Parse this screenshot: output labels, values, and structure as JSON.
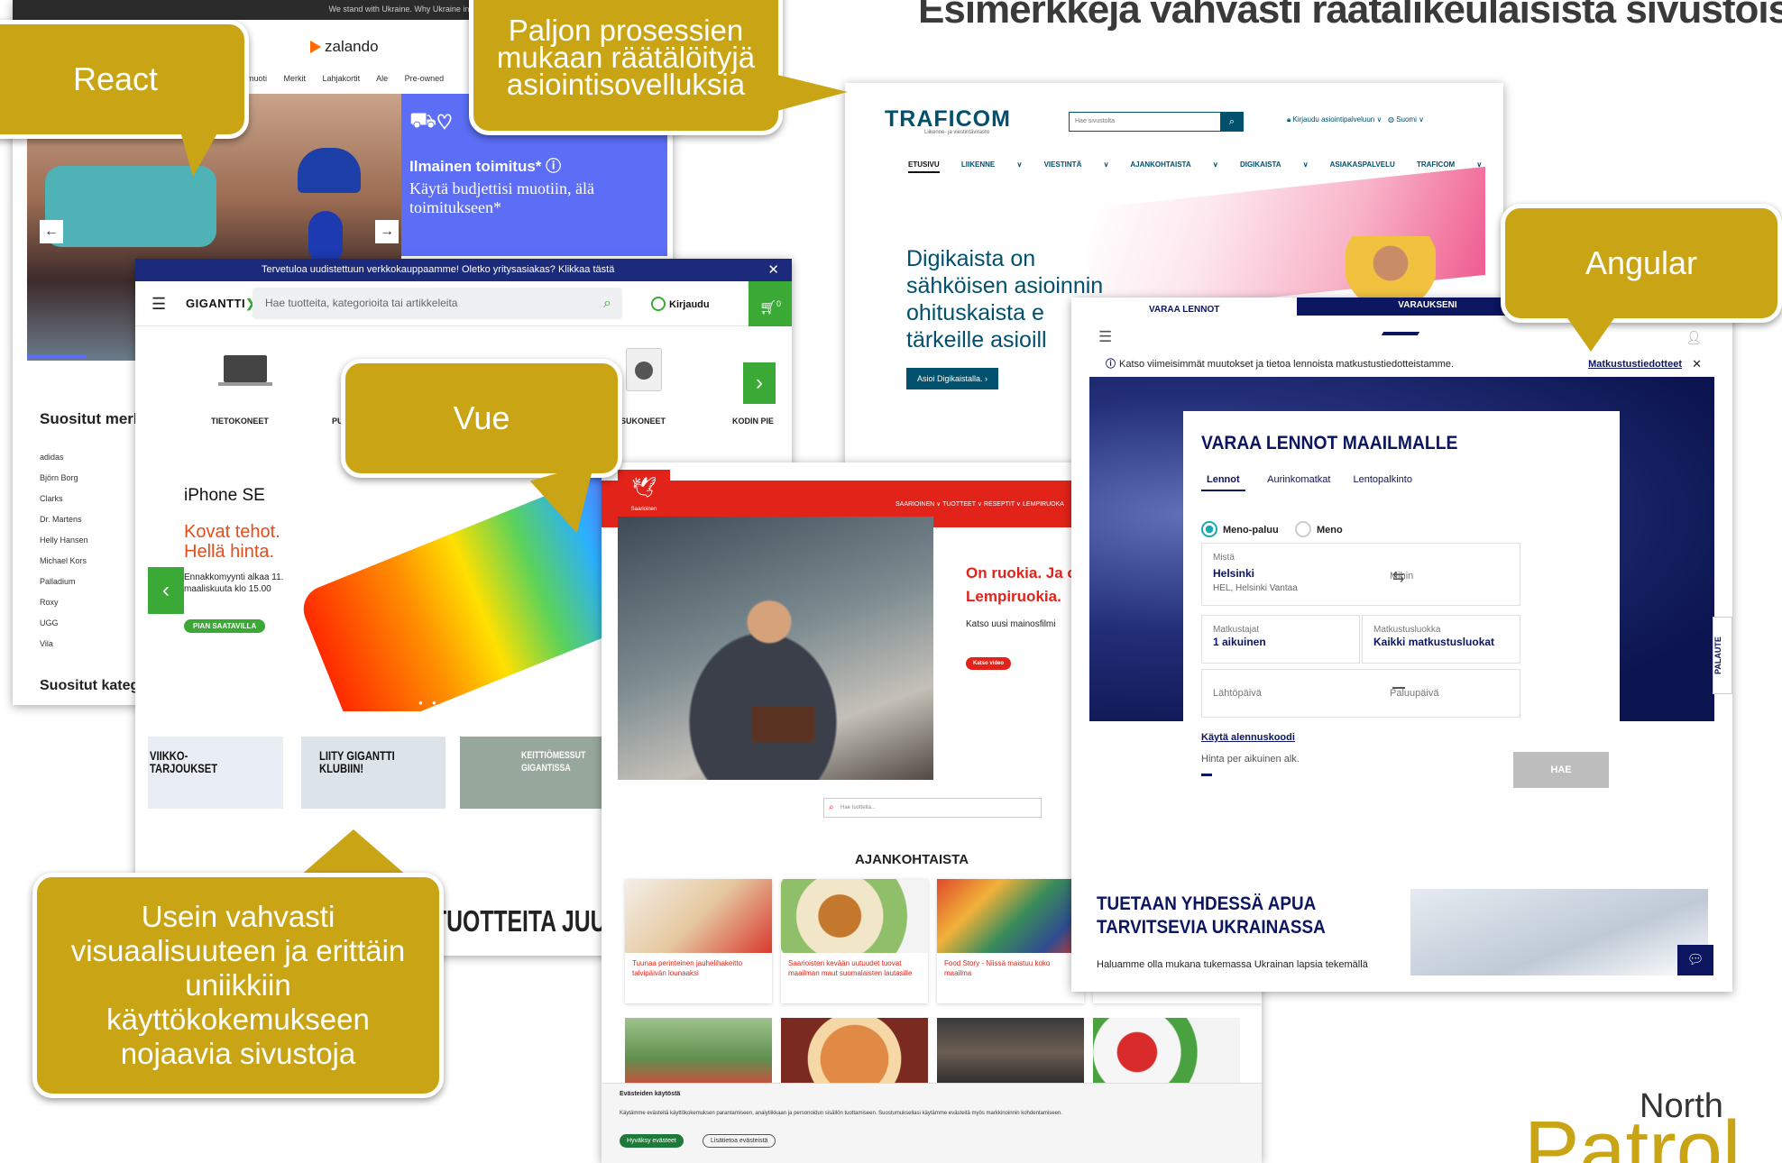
{
  "slide": {
    "title": "Esimerkkejä vahvasti räätälikeulaisista sivustoista"
  },
  "callouts": {
    "react": "React",
    "custom": "Paljon prosessien mukaan räätälöityjä asiointisovelluksia",
    "vue": "Vue",
    "angular": "Angular",
    "visual": "Usein vahvasti visuaalisuuteen ja erittäin uniikkiin käyttökokemukseen nojaavia sivustoja"
  },
  "zalando": {
    "topbar": "We stand with Ukraine. Why Ukraine in Zalando",
    "logo": "zalando",
    "nav": [
      "muoti",
      "Merkit",
      "Lahjakortit",
      "Ale",
      "Pre-owned"
    ],
    "promo_heading": "Ilmainen toimitus* ⓘ",
    "promo_body": "Käytä budjettisi muotiin, älä toimitukseen*",
    "popular_heading": "Suositut merkit",
    "brands": [
      "adidas",
      "Björn Borg",
      "Clarks",
      "Dr. Martens",
      "Helly Hansen",
      "Michael Kors",
      "Palladium",
      "Roxy",
      "UGG",
      "Vila"
    ],
    "categories_heading": "Suositut kategoriat"
  },
  "gigantti": {
    "banner": "Tervetuloa uudistettuun verkkokauppaamme! Oletko yritysasiakas? Klikkaa tästä",
    "logo": "GIGANTTI",
    "search_placeholder": "Hae tuotteita, kategorioita tai artikkeleita",
    "login": "Kirjaudu",
    "cart_count": "0",
    "categories": [
      "TIETOKONEET",
      "PU",
      "PYYKINPESUKONEET",
      "KODIN PIE"
    ],
    "promo": {
      "brand": "iPhone SE",
      "headline1": "Kovat tehot.",
      "headline2": "Hellä hinta.",
      "small1": "Ennakkomyynti alkaa 11.",
      "small2": "maaliskuuta klo 15.00",
      "badge": "PIAN SAATAVILLA"
    },
    "tiles": [
      "VIIKKO- TARJOUKSET",
      "LIITY GIGANTTI KLUBIIN!",
      "KEITTIÖMESSUT GIGANTISSA"
    ],
    "bottom_text": "TUOTTEITA JUURI NYT"
  },
  "traficom": {
    "logo": "TRAFICOM",
    "sublogo": "Liikenne- ja viestintävirasto",
    "search_placeholder": "Hae sivustolta",
    "login": "Kirjaudu asiointipalveluun",
    "language": "Suomi",
    "nav": [
      "ETUSIVU",
      "LIIKENNE",
      "VIESTINTÄ",
      "AJANKOHTAISTA",
      "DIGIKAISTA",
      "ASIAKASPALVELU",
      "TRAFICOM"
    ],
    "hero": [
      "Digikaista on",
      "sähköisen asioinnin",
      "ohituskaista e",
      "tärkeille asioill"
    ],
    "button": "Asioi Digikaistalla."
  },
  "saarioinen": {
    "logo": "Saarioinen",
    "nav": "SAARIOINEN ∨   TUOTTEET ∨   RESEPTIT ∨   LEMPIRUOKA",
    "headline1": "On ruokia. Ja on",
    "headline2": "Lempiruokia.",
    "body": "Katso uusi mainosfilmi",
    "button": "Katso video",
    "search_placeholder": "Hae tuotteita...",
    "section_title": "AJANKOHTAISTA",
    "cards": [
      "Tuunaa perinteinen jauhelihakeitto talvipäivän lounaaksi",
      "Saarioisten kevään uutuudet tuovat maailman maut suomalaisten lautasille",
      "Food Story - Niissä maistuu koko maailma"
    ],
    "cookie_heading": "Evästeiden käytöstä",
    "cookie_body": "Käytämme evästeitä käyttökokemuksen parantamiseen, analytiikkaan ja personoidun sisällön tuottamiseen. Suostumuksellasi käytämme evästeitä myös markkinoinnin kohdentamiseen.",
    "cookie_accept": "Hyväksy evästeet",
    "cookie_more": "Lisätietoa evästeistä"
  },
  "finnair": {
    "tab1": "VARAA LENNOT",
    "tab2": "VARAUKSENI",
    "notice": "Katso viimeisimmät muutokset ja tietoa lennoista matkustustiedotteistamme.",
    "notice_link": "Matkustustiedotteet",
    "panel_title": "VARAA LENNOT MAAILMALLE",
    "tabs": [
      "Lennot",
      "Aurinkomatkat",
      "Lentopalkinto"
    ],
    "radio_roundtrip": "Meno-paluu",
    "radio_oneway": "Meno",
    "from_label": "Mistä",
    "from_value": "Helsinki",
    "from_sub": "HEL, Helsinki Vantaa",
    "to_label": "Mihin",
    "passengers_label": "Matkustajat",
    "passengers_value": "1 aikuinen",
    "class_label": "Matkustusluokka",
    "class_value": "Kaikki matkustusluokat",
    "depart_label": "Lähtöpäivä",
    "return_label": "Paluupäivä",
    "discount_link": "Käytä alennuskoodi",
    "price_note": "Hinta per aikuinen alk.",
    "search_button": "HAE",
    "feedback": "PALAUTE",
    "ukraine_title1": "TUETAAN YHDESSÄ APUA",
    "ukraine_title2": "TARVITSEVIA UKRAINASSA",
    "ukraine_body": "Haluamme olla mukana tukemassa Ukrainan lapsia tekemällä"
  },
  "logo": {
    "north": "North",
    "patrol": "Patrol"
  }
}
